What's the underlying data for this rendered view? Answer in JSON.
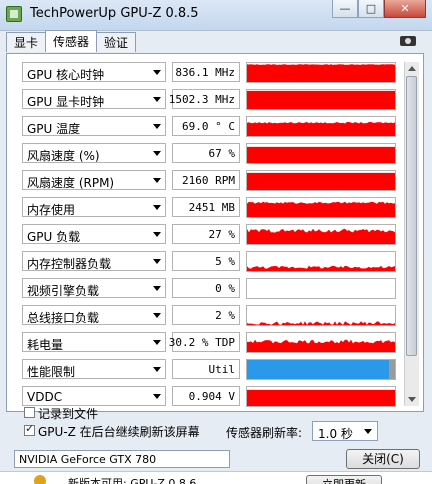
{
  "window": {
    "title": "TechPowerUp GPU-Z 0.8.5",
    "minimize": "—",
    "maximize": "□",
    "close": "✕"
  },
  "tabs": [
    {
      "label": "显卡",
      "active": false
    },
    {
      "label": "传感器",
      "active": true
    },
    {
      "label": "验证",
      "active": false
    }
  ],
  "colors": {
    "graph": "#ff0000",
    "perfcap_bar": "#2b99ea",
    "perfcap_tail": "#9a9a9a"
  },
  "sensors": [
    {
      "label": "GPU 核心时钟",
      "value": "836.1 MHz",
      "level": 0.92,
      "noise": 0.02
    },
    {
      "label": "GPU 显卡时钟",
      "value": "1502.3 MHz",
      "level": 0.95,
      "noise": 0.0
    },
    {
      "label": "GPU 温度",
      "value": "69.0 ° C",
      "level": 0.7,
      "noise": 0.04
    },
    {
      "label": "风扇速度 (%)",
      "value": "67 %",
      "level": 0.85,
      "noise": 0.0
    },
    {
      "label": "风扇速度 (RPM)",
      "value": "2160 RPM",
      "level": 0.9,
      "noise": 0.0
    },
    {
      "label": "内存使用",
      "value": "2451 MB",
      "level": 0.75,
      "noise": 0.05
    },
    {
      "label": "GPU 负载",
      "value": "27 %",
      "level": 0.7,
      "noise": 0.1
    },
    {
      "label": "内存控制器负载",
      "value": "5 %",
      "level": 0.2,
      "noise": 0.08
    },
    {
      "label": "视频引擎负载",
      "value": "0 %",
      "level": 0.0,
      "noise": 0.0
    },
    {
      "label": "总线接口负载",
      "value": "2 %",
      "level": 0.1,
      "noise": 0.1
    },
    {
      "label": "耗电量",
      "value": "30.2 % TDP",
      "level": 0.55,
      "noise": 0.1
    },
    {
      "label": "性能限制",
      "value": "Util",
      "level": 1.0,
      "noise": 0.0,
      "style": "perfcap"
    },
    {
      "label": "VDDC",
      "value": "0.904 V",
      "level": 0.85,
      "noise": 0.0
    }
  ],
  "options": {
    "log_to_file": {
      "label": "记录到文件",
      "checked": false
    },
    "background_refresh": {
      "label": "GPU-Z 在后台继续刷新该屏幕",
      "checked": true
    }
  },
  "refresh": {
    "label": "传感器刷新率:",
    "value": "1.0 秒"
  },
  "gpu_select": {
    "value": "NVIDIA GeForce GTX 780"
  },
  "close_button": "关闭(C)",
  "update_bar": {
    "text": "新版本可用: GPU-Z 0.8.6",
    "button": "立即更新"
  }
}
